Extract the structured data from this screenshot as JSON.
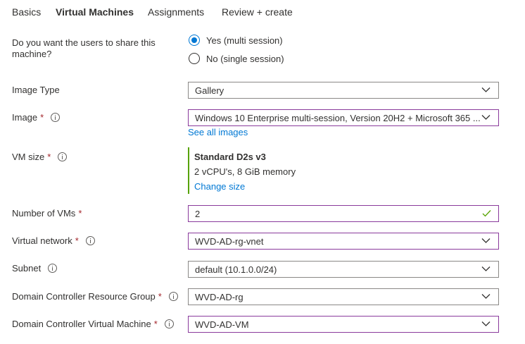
{
  "tabs": [
    {
      "label": "Basics"
    },
    {
      "label": "Virtual Machines"
    },
    {
      "label": "Assignments"
    },
    {
      "label": "Review + create"
    }
  ],
  "share": {
    "label_line1": "Do you want the users to share this",
    "label_line2": "machine?",
    "options": [
      {
        "label": "Yes (multi session)",
        "checked": true
      },
      {
        "label": "No (single session)",
        "checked": false
      }
    ]
  },
  "image_type": {
    "label": "Image Type",
    "value": "Gallery"
  },
  "image": {
    "label": "Image",
    "required": "*",
    "value": "Windows 10 Enterprise multi-session, Version 20H2 + Microsoft 365 ...",
    "link": "See all images"
  },
  "vm_size": {
    "label": "VM size",
    "required": "*",
    "name": "Standard D2s v3",
    "desc": "2 vCPU's, 8 GiB memory",
    "link": "Change size"
  },
  "num_vms": {
    "label": "Number of VMs",
    "required": "*",
    "value": "2"
  },
  "vnet": {
    "label": "Virtual network",
    "required": "*",
    "value": "WVD-AD-rg-vnet"
  },
  "subnet": {
    "label": "Subnet",
    "value": "default (10.1.0.0/24)"
  },
  "dc_rg": {
    "label": "Domain Controller Resource Group",
    "required": "*",
    "value": "WVD-AD-rg"
  },
  "dc_vm": {
    "label": "Domain Controller Virtual Machine",
    "required": "*",
    "value": "WVD-AD-VM"
  },
  "colors": {
    "accent": "#0078d4",
    "required": "#a4262c",
    "success": "#57a300",
    "focus_border": "#8a3a9c"
  }
}
